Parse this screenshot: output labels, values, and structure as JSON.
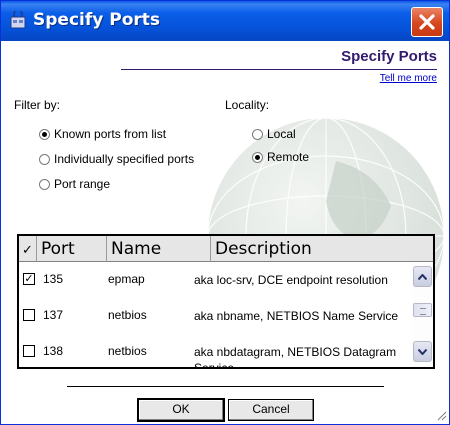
{
  "window": {
    "title": "Specify Ports"
  },
  "header": {
    "title": "Specify Ports",
    "link": "Tell me more"
  },
  "filter": {
    "label": "Filter by:",
    "options": [
      {
        "label": "Known ports from list",
        "checked": true
      },
      {
        "label": "Individually specified ports",
        "checked": false
      },
      {
        "label": "Port range",
        "checked": false
      }
    ]
  },
  "locality": {
    "label": "Locality:",
    "options": [
      {
        "label": "Local",
        "checked": false
      },
      {
        "label": "Remote",
        "checked": true
      }
    ]
  },
  "table": {
    "headers": {
      "check": "✓",
      "port": "Port",
      "name": "Name",
      "description": "Description"
    },
    "rows": [
      {
        "checked": true,
        "port": "135",
        "name": "epmap",
        "description": "aka loc-srv, DCE endpoint resolution"
      },
      {
        "checked": false,
        "port": "137",
        "name": "netbios",
        "description": "aka nbname, NETBIOS Name Service"
      },
      {
        "checked": false,
        "port": "138",
        "name": "netbios",
        "description": "aka nbdatagram, NETBIOS Datagram Service"
      }
    ]
  },
  "buttons": {
    "ok": "OK",
    "cancel": "Cancel"
  },
  "colors": {
    "titlebar": "#0552d8",
    "header_text": "#331a6e",
    "link": "#0000cc",
    "close": "#d7461e"
  }
}
